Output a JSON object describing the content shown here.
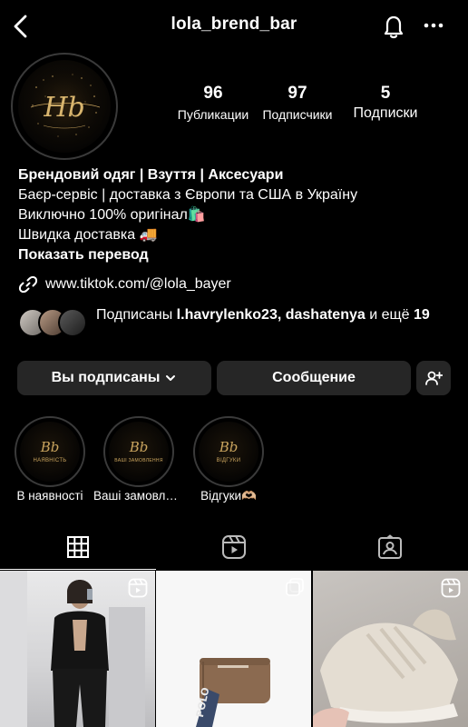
{
  "header": {
    "username": "lola_brend_bar"
  },
  "profile": {
    "avatar_logo": "Hb",
    "stats": [
      {
        "value": "96",
        "label": "Публикации"
      },
      {
        "value": "97",
        "label": "Подписчики"
      },
      {
        "value": "5",
        "label": "Подписки"
      }
    ],
    "bio": {
      "name": "Брендовий одяг | Взуття | Аксесуари",
      "lines": [
        "Баєр-сервіс | доставка з Європи та США в Україну",
        "Виключно 100% оригінал🛍️",
        "Швидка доставка 🚚"
      ],
      "translate": "Показать перевод"
    },
    "link": "www.tiktok.com/@lola_bayer",
    "followed_by": {
      "prefix": "Подписаны ",
      "names": "l.havrylenko23, dashatenya",
      "middle": " и ещё ",
      "count": "19"
    }
  },
  "buttons": {
    "subscribed": "Вы подписаны",
    "message": "Сообщение"
  },
  "highlights": [
    {
      "logo": "Bb",
      "inner": "НАЯВНІСТЬ",
      "label": "В наявності"
    },
    {
      "logo": "Bb",
      "inner": "ВАШІ ЗАМОВЛЕННЯ",
      "label": "Ваші замовлення"
    },
    {
      "logo": "Bb",
      "inner": "ВІДГУКИ",
      "label": "Відгуки🫶🏼"
    }
  ],
  "tabs": [
    {
      "icon": "grid-icon"
    },
    {
      "icon": "reels-icon"
    },
    {
      "icon": "tagged-icon"
    }
  ],
  "posts": [
    {
      "type": "reel",
      "badge": "reels-icon"
    },
    {
      "type": "carousel",
      "badge": "carousel-icon",
      "product_text": "POLO"
    },
    {
      "type": "reel",
      "badge": "reels-icon"
    }
  ],
  "colors": {
    "accent_gold": "#c9a45e",
    "button_bg": "#262626"
  }
}
